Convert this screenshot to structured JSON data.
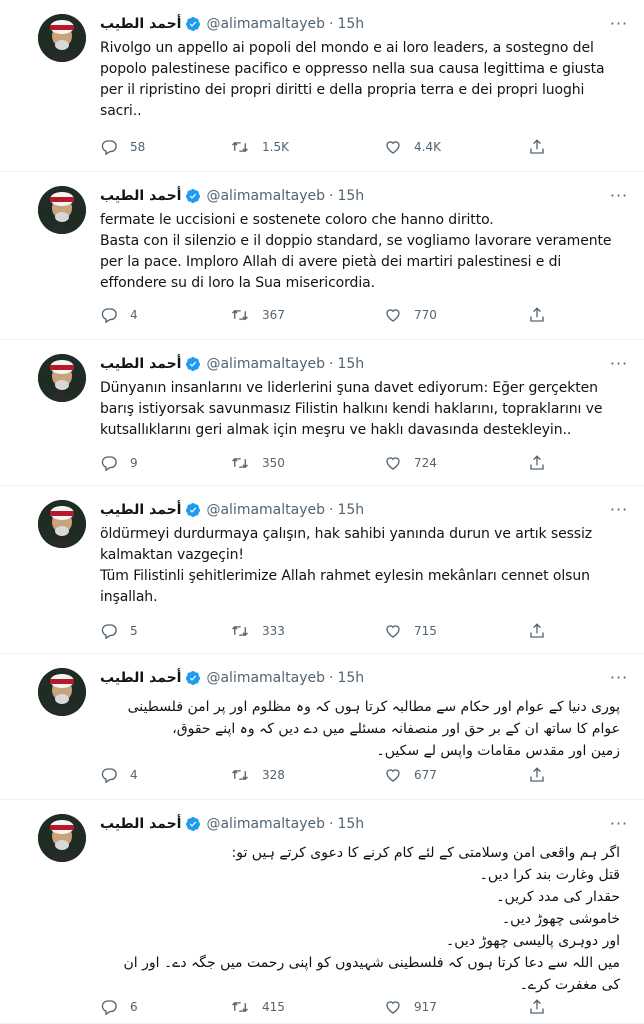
{
  "author": {
    "name": "أحمد الطيب",
    "handle": "@alimamaltayeb",
    "separator": "·",
    "icons": {
      "avatar": "avatar-portrait",
      "verified": "verified-badge-icon"
    }
  },
  "icons": {
    "reply": "reply-icon",
    "retweet": "retweet-icon",
    "like": "heart-icon",
    "share": "share-icon",
    "more": "more-options-icon"
  },
  "colors": {
    "verified": "#1d9bf0",
    "secondary_text": "#536471",
    "divider": "#eff3f4"
  },
  "tweets": [
    {
      "time": "15h",
      "lines": [
        "Rivolgo un appello ai popoli del mondo e ai loro leaders, a sostegno del",
        "popolo palestinese pacifico e oppresso nella sua causa legittima e giusta",
        "per il ripristino dei propri diritti e della propria terra e dei propri luoghi",
        "sacri.."
      ],
      "replies": "58",
      "retweets": "1.5K",
      "likes": "4.4K"
    },
    {
      "time": "15h",
      "lines": [
        "fermate le uccisioni e sostenete coloro che hanno diritto.",
        "Basta con il silenzio e il doppio standard, se vogliamo lavorare veramente",
        "per la pace. Imploro Allah di avere pietà dei martiri palestinesi e di",
        "effondere su di loro la Sua misericordia."
      ],
      "replies": "4",
      "retweets": "367",
      "likes": "770"
    },
    {
      "time": "15h",
      "lines": [
        "Dünyanın insanlarını ve liderlerini şuna davet ediyorum: Eğer gerçekten",
        "barış istiyorsak savunmasız Filistin halkını kendi haklarını, topraklarını ve",
        "kutsallıklarını geri almak için meşru ve haklı davasında destekleyin.."
      ],
      "replies": "9",
      "retweets": "350",
      "likes": "724"
    },
    {
      "time": "15h",
      "lines": [
        "öldürmeyi durdurmaya çalışın, hak sahibi yanında durun ve artık sessiz",
        "kalmaktan vazgeçin!",
        "Tüm Filistinli şehitlerimize Allah rahmet eylesin mekânları cennet olsun",
        "inşallah."
      ],
      "replies": "5",
      "retweets": "333",
      "likes": "715"
    },
    {
      "time": "15h",
      "lines": [
        "پوری دنیا کے عوام اور حکام سے مطالبہ کرتا ہوں کہ وہ مظلوم اور پر امن فلسطینی",
        "عوام کا ساتھ ان کے بر حق اور منصفانہ مسئلے میں دے دیں کہ وہ اپنے حقوق،",
        "زمین اور مقدس مقامات واپس لے سکیں۔"
      ],
      "replies": "4",
      "retweets": "328",
      "likes": "677"
    },
    {
      "time": "15h",
      "lines": [
        "اگر ہم واقعی امن وسلامتی کے لئے کام کرنے کا دعوی کرتے ہیں تو:",
        "قتل وغارت بند کرا دیں۔",
        "حقدار کی مدد کریں۔",
        "خاموشی چھوڑ دیں۔",
        "اور دوہری پالیسی چھوڑ دیں۔",
        "میں اللہ سے دعا کرتا ہوں کہ فلسطینی شہیدوں کو اپنی رحمت میں جگہ دے۔ اور ان",
        "کی مغفرت کرے۔"
      ],
      "replies": "6",
      "retweets": "415",
      "likes": "917"
    }
  ]
}
